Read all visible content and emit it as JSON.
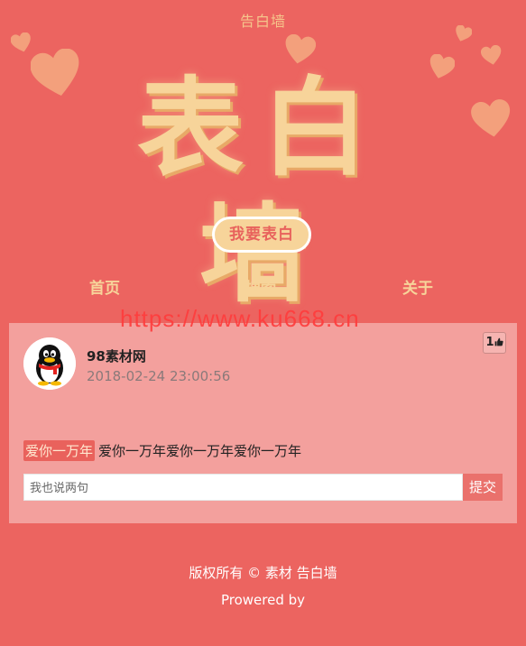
{
  "header": {
    "site_title": "告白墙",
    "hero_title": "表白墙",
    "confess_button": "我要表白"
  },
  "nav": {
    "items": [
      {
        "label": "首页"
      },
      {
        "label": "搜索"
      },
      {
        "label": "关于"
      }
    ]
  },
  "watermark": "https://www.ku668.cn",
  "post": {
    "username": "98素材网",
    "timestamp": "2018-02-24 23:00:56",
    "like_count": "1",
    "like_icon": "thumbs-up-icon",
    "tag": "爱你一万年",
    "message": "爱你一万年爱你一万年爱你一万年",
    "reply_placeholder": "我也说两句",
    "submit_label": "提交"
  },
  "footer": {
    "copyright": "版权所有 © 素材 告白墙",
    "powered": "Prowered by"
  },
  "colors": {
    "background": "#ec6460",
    "accent": "#f7d49a",
    "card": "#f3a09d",
    "heart": "#f3a07c"
  }
}
